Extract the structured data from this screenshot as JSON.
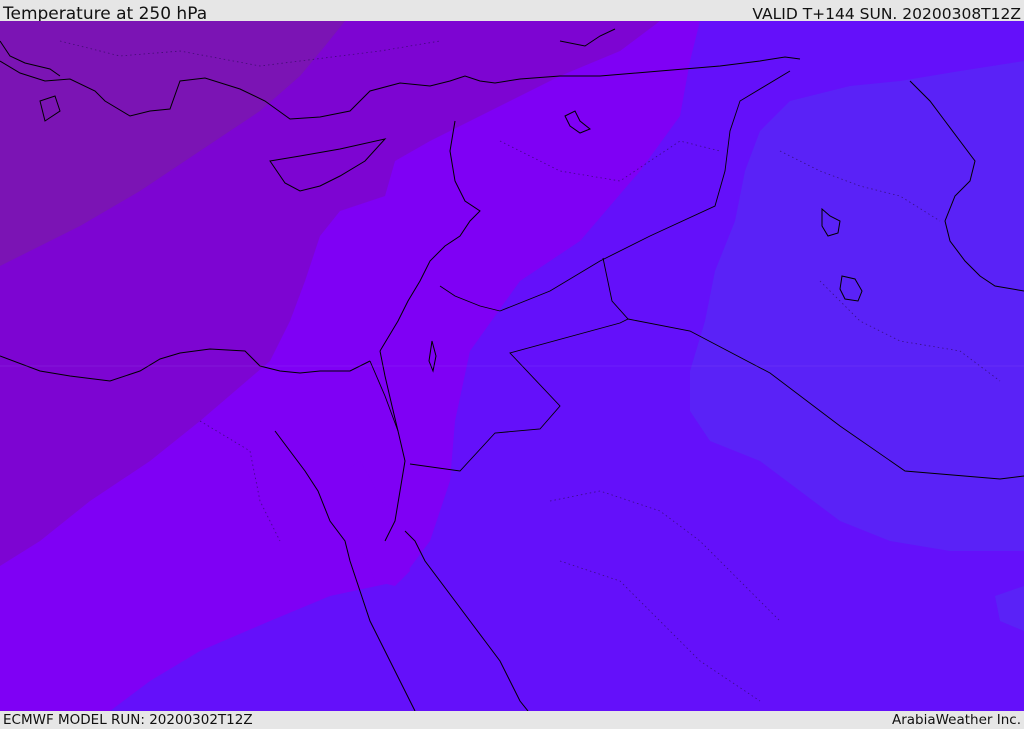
{
  "header": {
    "title": "Temperature at 250 hPa",
    "valid": "VALID T+144 SUN. 20200308T12Z"
  },
  "footer": {
    "model_run": "ECMWF MODEL RUN: 20200302T12Z",
    "credit": "ArabiaWeather Inc."
  },
  "map": {
    "colors": {
      "band_1": "#7b14b4",
      "band_2": "#7d05d2",
      "band_3": "#7f00f5",
      "band_4": "#6410fa",
      "band_5": "#5a22f7",
      "coastline": "#000000",
      "border": "#000000"
    }
  }
}
